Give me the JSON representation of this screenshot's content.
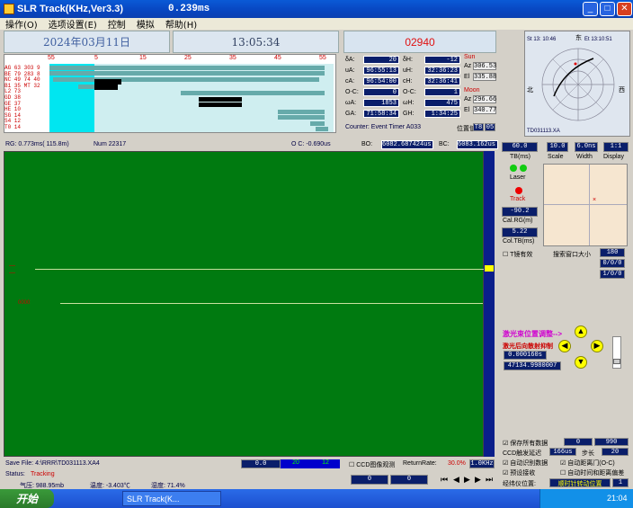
{
  "window": {
    "title": "SLR Track(KHz,Ver3.3)",
    "time_readout": "0.239ms"
  },
  "menu": [
    "操作(O)",
    "选项设置(E)",
    "控制",
    "模拟",
    "帮助(H)"
  ],
  "header": {
    "date": "2024年03月11日",
    "clock": "13:05:34",
    "pass_id": "02940"
  },
  "timeline": {
    "ticks": [
      "55",
      "5",
      "15",
      "25",
      "35",
      "45",
      "55"
    ],
    "stations": [
      {
        "code": "AG",
        "n1": "63",
        "n2": "303",
        "n3": "9"
      },
      {
        "code": "BE",
        "n1": "79",
        "n2": "283",
        "n3": "8"
      },
      {
        "code": "NC",
        "n1": "49",
        "n2": "74",
        "n3": "40"
      },
      {
        "code": "B1",
        "n1": "35",
        "n2": "MT",
        "n3": "32"
      },
      {
        "code": "L2",
        "n1": "73",
        "n2": "",
        "n3": ""
      },
      {
        "code": "GD",
        "n1": "38",
        "n2": "",
        "n3": ""
      },
      {
        "code": "GE",
        "n1": "37",
        "n2": "",
        "n3": ""
      },
      {
        "code": "HE",
        "n1": "10",
        "n2": "",
        "n3": ""
      },
      {
        "code": "SG",
        "n1": "14",
        "n2": "",
        "n3": ""
      },
      {
        "code": "S4",
        "n1": "12",
        "n2": "",
        "n3": ""
      },
      {
        "code": "T0",
        "n1": "14",
        "n2": "",
        "n3": ""
      }
    ]
  },
  "params": {
    "dA": "20",
    "dH": "-12",
    "uA": "96:55:13",
    "uH": "32:36:23",
    "cA": "96:54:00",
    "cH": "32:36:41",
    "OC1": "0",
    "OC2": "1",
    "wA": "1853",
    "wH": "475",
    "GA": "71:58:34",
    "GH": "1:34:25",
    "sun_label": "Sun",
    "sun_az": "306.53",
    "sun_el": "335.88",
    "moon_label": "Moon",
    "moon_az": "296.66",
    "moon_el": "340.77",
    "counter": "Counter: Event Timer A033",
    "pos_label": "位置值",
    "pos_v1": "T8",
    "pos_v2": "05"
  },
  "skyplot": {
    "start": "St 13: 10:46",
    "end": "Et 13:10:51",
    "n": "东",
    "e": "西",
    "s": "南",
    "w": "北",
    "file": "TD031113.XA"
  },
  "info_bar": {
    "rg": "RG: 0.773ms( 115.8m)",
    "num": "Num  22317",
    "oc": "O C: -0.690us",
    "bo_label": "BO:",
    "bo": "6082.687424us",
    "bc_label": "BC:",
    "bc": "6083.162us"
  },
  "plot": {
    "y_tick": "0000"
  },
  "right_panel": {
    "tb_val": "60.0",
    "tb_label": "TB(ms)",
    "laser": "Laser",
    "track": "Track",
    "scale_val": "10.0",
    "scale": "Scale",
    "width_val": "6.0ns",
    "width": "Width",
    "disp_val": "1:1",
    "disp": "Display",
    "cal_val": "-90.2",
    "cal_label": "Cal.RG(m)",
    "calt_val": "5.22",
    "calt_label": "Col.TB(ms)",
    "tmirror": "T镜有效",
    "search_label": "搜索窗口大小",
    "search_val": "180",
    "r1": "0/0/0",
    "r2": "1/0/0",
    "laser_adj": "激光束位置调整-->",
    "laser_ctrl": "激光后向散射抑制",
    "adj1": "0.000160s",
    "adj2": "47134.9980007"
  },
  "bottom": {
    "save_file": "Save File: 4:\\RRR\\TD031113.XA4",
    "status_label": "Status:",
    "status": "Tracking",
    "pressure": "气压: 988.95mb",
    "temp": "温度: -3.403℃",
    "humidity": "湿度: 71.4%",
    "b1": "0.0",
    "b2": "20",
    "b3": "12",
    "ccd": "CCD图像观测",
    "return_label": "ReturnRate:",
    "return_rate": "30.0%",
    "rate_val": "1.0KHz",
    "c1": "0",
    "c2": "0"
  },
  "options": {
    "save_all": "保存所有数据",
    "v1": "0",
    "v2": "990",
    "ccd_delay": "CCD触发延迟",
    "ccd_val": "166us",
    "step": "步长",
    "step_val": "20",
    "auto_id": "自动识别数据",
    "auto_door": "自动距离门(O-C)",
    "prev_recv": "预设接收",
    "auto_time": "自动时间和距离偏差",
    "mode": "经纬仪位置:",
    "mode_val": "顺时针转动位置",
    "mode_n": "1"
  },
  "taskbar": {
    "start": "开始",
    "task": "SLR Track(K...",
    "clock": "21:04"
  }
}
